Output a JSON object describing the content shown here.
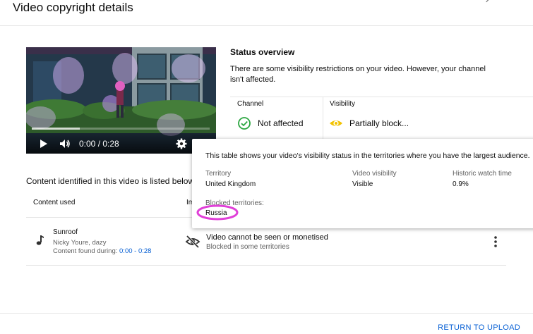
{
  "header": {
    "title": "Video copyright details"
  },
  "player": {
    "time": "0:00 / 0:28",
    "progress_fraction": 0.27
  },
  "status": {
    "title": "Status overview",
    "description": "There are some visibility restrictions on your video. However, your channel isn't affected.",
    "channel_label": "Channel",
    "channel_value": "Not affected",
    "visibility_label": "Visibility",
    "visibility_value": "Partially block..."
  },
  "content": {
    "section_title": "Content identified in this video is listed below",
    "col_content": "Content used",
    "col_impact": "Im",
    "rows": [
      {
        "song": "Sunroof",
        "artist": "Nicky Youre, dazy",
        "found_label": "Content found during:",
        "found_range": "0:00 - 0:28",
        "impact_main": "Video cannot be seen or monetised",
        "impact_sub": "Blocked in some territories"
      }
    ]
  },
  "popup": {
    "intro": "This table shows your video's visibility status in the territories where you have the largest audience.",
    "head_territory": "Territory",
    "head_visibility": "Video visibility",
    "head_watch": "Historic watch time",
    "territory": "United Kingdom",
    "visibility": "Visible",
    "watch": "0.9%",
    "blocked_label": "Blocked territories:",
    "blocked_value": "Russia"
  },
  "footer": {
    "return_label": "RETURN TO UPLOAD"
  },
  "colors": {
    "accent_blue": "#065fd4",
    "ok_green": "#2ba640",
    "warn_yellow": "#f2c200",
    "highlight_magenta": "#e040d8"
  },
  "icons": [
    "play-icon",
    "volume-icon",
    "settings-icon",
    "check-circle-icon",
    "eye-icon",
    "music-note-icon",
    "eye-off-icon",
    "more-vert-icon"
  ]
}
